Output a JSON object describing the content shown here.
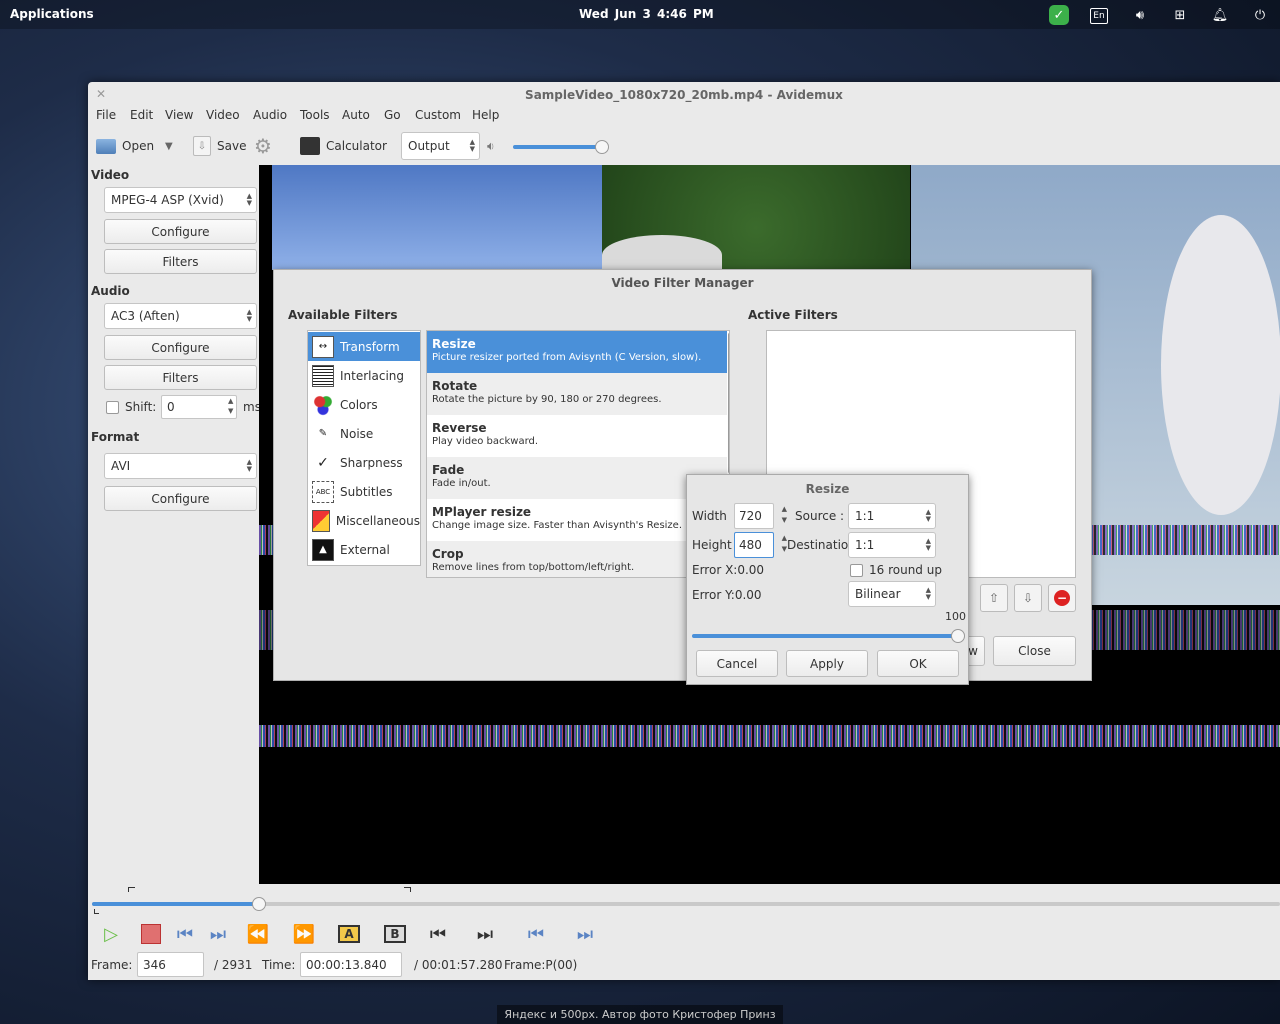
{
  "panel": {
    "applications": "Applications",
    "clock": "Wed Jun  3    4:46 PM",
    "lang": "En"
  },
  "window": {
    "title": "SampleVideo_1080x720_20mb.mp4 - Avidemux",
    "menu": [
      "File",
      "Edit",
      "View",
      "Video",
      "Audio",
      "Tools",
      "Auto",
      "Go",
      "Custom",
      "Help"
    ],
    "toolbar": {
      "open": "Open",
      "save": "Save",
      "calculator": "Calculator",
      "output": "Output",
      "volume_fraction": 0.9
    }
  },
  "sidebar": {
    "video_label": "Video",
    "video_codec": "MPEG-4 ASP (Xvid)",
    "configure": "Configure",
    "filters": "Filters",
    "audio_label": "Audio",
    "audio_codec": "AC3 (Aften)",
    "shift_label": "Shift:",
    "shift_value": "0",
    "shift_unit": "ms",
    "format_label": "Format",
    "format_value": "AVI"
  },
  "filter_manager": {
    "title": "Video Filter Manager",
    "available_label": "Available Filters",
    "active_label": "Active Filters",
    "categories": [
      "Transform",
      "Interlacing",
      "Colors",
      "Noise",
      "Sharpness",
      "Subtitles",
      "Miscellaneous",
      "External"
    ],
    "selected_category": "Transform",
    "filters": [
      {
        "name": "Resize",
        "desc": "Picture resizer ported from Avisynth (C Version, slow)."
      },
      {
        "name": "Rotate",
        "desc": "Rotate the picture by 90, 180 or 270 degrees."
      },
      {
        "name": "Reverse",
        "desc": "Play video backward."
      },
      {
        "name": "Fade",
        "desc": "Fade in/out."
      },
      {
        "name": "MPlayer resize",
        "desc": "Change image size. Faster than Avisynth's Resize."
      },
      {
        "name": "Crop",
        "desc": "Remove lines from top/bottom/left/right."
      }
    ],
    "preview_partial": "w",
    "close": "Close"
  },
  "resize_dialog": {
    "title": "Resize",
    "width_label": "Width",
    "width_value": "720",
    "height_label": "Height",
    "height_value": "480",
    "source_label": "Source :",
    "source_value": "1:1",
    "destination_label": "Destination",
    "destination_value": "1:1",
    "round_label": "16 round up",
    "error_x": "Error X:0.00",
    "error_y": "Error Y:0.00",
    "algorithm": "Bilinear",
    "percent_value": "100",
    "cancel": "Cancel",
    "apply": "Apply",
    "ok": "OK"
  },
  "navigation": {
    "frame_label": "Frame:",
    "frame_value": "346",
    "frame_total": "/ 2931",
    "time_label": "Time:",
    "time_value": "00:00:13.840",
    "time_total": "/ 00:01:57.280",
    "frame_type": "Frame:P(00)",
    "position_fraction": 0.14
  },
  "caption": "Яндекс и 500px. Автор фото Кристофер Принз",
  "colors": {
    "accent": "#4a90d9",
    "panel": "#000000"
  }
}
